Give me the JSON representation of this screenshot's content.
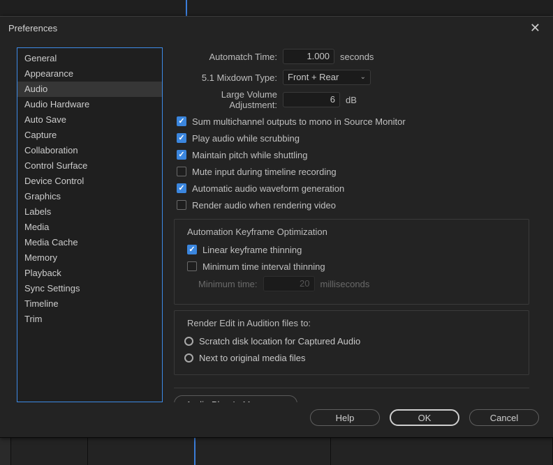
{
  "window": {
    "title": "Preferences"
  },
  "sidebar": {
    "selected": 2,
    "items": [
      {
        "label": "General"
      },
      {
        "label": "Appearance"
      },
      {
        "label": "Audio"
      },
      {
        "label": "Audio Hardware"
      },
      {
        "label": "Auto Save"
      },
      {
        "label": "Capture"
      },
      {
        "label": "Collaboration"
      },
      {
        "label": "Control Surface"
      },
      {
        "label": "Device Control"
      },
      {
        "label": "Graphics"
      },
      {
        "label": "Labels"
      },
      {
        "label": "Media"
      },
      {
        "label": "Media Cache"
      },
      {
        "label": "Memory"
      },
      {
        "label": "Playback"
      },
      {
        "label": "Sync Settings"
      },
      {
        "label": "Timeline"
      },
      {
        "label": "Trim"
      }
    ]
  },
  "fields": {
    "automatch": {
      "label": "Automatch Time:",
      "value": "1.000",
      "suffix": "seconds"
    },
    "mixdown": {
      "label": "5.1 Mixdown Type:",
      "value": "Front + Rear"
    },
    "large_volume": {
      "label": "Large Volume Adjustment:",
      "value": "6",
      "suffix": "dB"
    }
  },
  "checks": {
    "sum_multi": {
      "label": "Sum multichannel outputs to mono in Source Monitor",
      "checked": true
    },
    "scrub": {
      "label": "Play audio while scrubbing",
      "checked": true
    },
    "pitch": {
      "label": "Maintain pitch while shuttling",
      "checked": true
    },
    "mute_input": {
      "label": "Mute input during timeline recording",
      "checked": false
    },
    "auto_wave": {
      "label": "Automatic audio waveform generation",
      "checked": true
    },
    "render_aud": {
      "label": "Render audio when rendering video",
      "checked": false
    }
  },
  "automation": {
    "legend": "Automation Keyframe Optimization",
    "linear": {
      "label": "Linear keyframe thinning",
      "checked": true
    },
    "interval": {
      "label": "Minimum time interval thinning",
      "checked": false
    },
    "min_time": {
      "label": "Minimum time:",
      "value": "20",
      "suffix": "milliseconds"
    }
  },
  "render_edit": {
    "legend": "Render Edit in Audition files to:",
    "opt1": {
      "label": "Scratch disk location for Captured Audio",
      "selected": true
    },
    "opt2": {
      "label": "Next to original media files",
      "selected": false
    }
  },
  "plugin_manager": "Audio Plug-In Manager...",
  "buttons": {
    "help": "Help",
    "ok": "OK",
    "cancel": "Cancel"
  }
}
